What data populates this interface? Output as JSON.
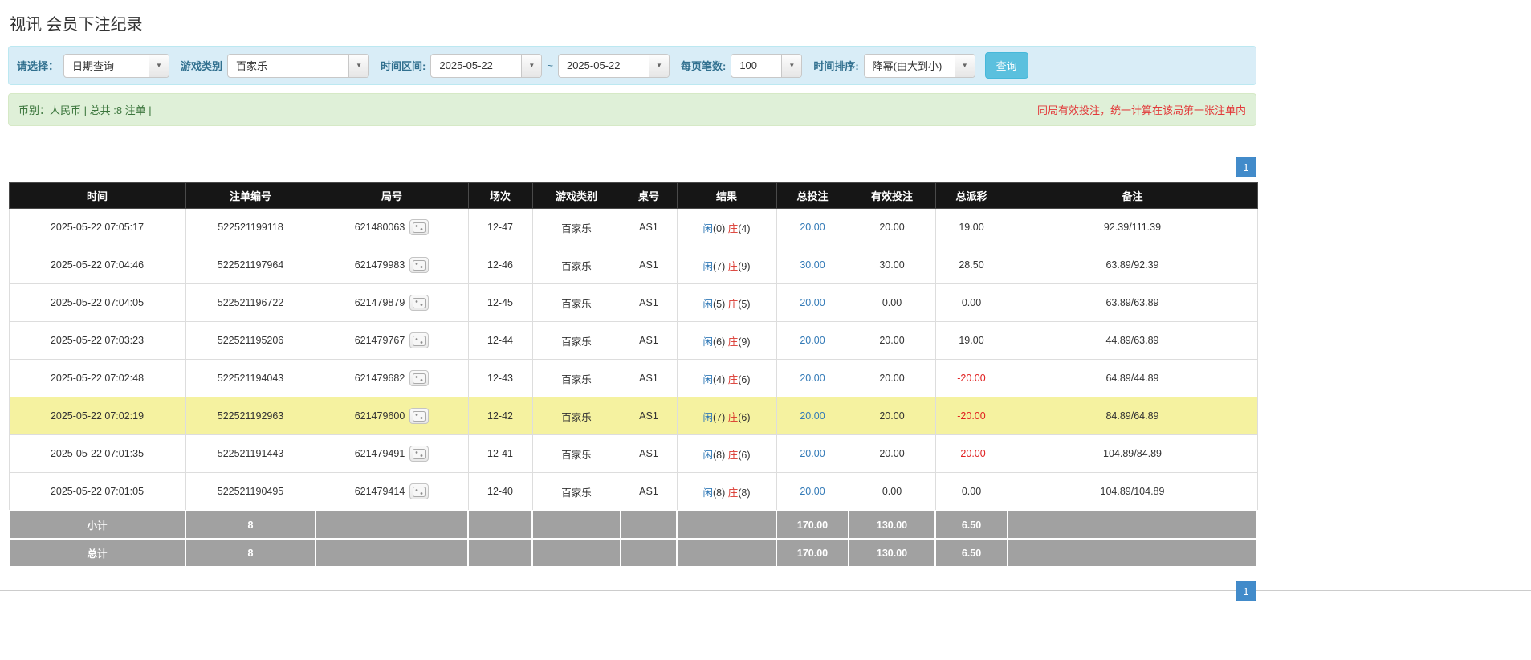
{
  "page": {
    "title": "视讯 会员下注纪录"
  },
  "colors": {
    "accent_blue": "#428bca",
    "link_blue": "#337ab7",
    "banker_red": "#d9342b",
    "negative_red": "#e02020",
    "highlight_yellow": "#f5f2a0",
    "filter_bg": "#d9edf7",
    "summary_bg": "#dff0d8",
    "header_black": "#161616",
    "footer_gray": "#a1a1a1"
  },
  "icons": {
    "dropdown_caret": "▼",
    "round_result_icon": "dice-icon"
  },
  "filters": {
    "select_label": "请选择：",
    "select_value": "日期查询",
    "game_type_label": "游戏类别",
    "game_type_value": "百家乐",
    "time_range_label": "时间区间:",
    "date_from": "2025-05-22",
    "tilde": "~",
    "date_to": "2025-05-22",
    "page_size_label": "每页笔数:",
    "page_size_value": "100",
    "sort_label": "时间排序:",
    "sort_value": "降幂(由大到小)",
    "search_button": "查询"
  },
  "summary": {
    "left": "币别：人民币 | 总共 :8 注单 |",
    "right": "同局有效投注，统一计算在该局第一张注单内"
  },
  "pagination": {
    "page": "1"
  },
  "table": {
    "headers": [
      "时间",
      "注单编号",
      "局号",
      "场次",
      "游戏类别",
      "桌号",
      "结果",
      "总投注",
      "有效投注",
      "总派彩",
      "备注"
    ],
    "rows": [
      {
        "time": "2025-05-22 07:05:17",
        "bet_id": "522521199118",
        "round_id": "621480063",
        "session": "12-47",
        "game": "百家乐",
        "table_no": "AS1",
        "result_player": "闲",
        "result_player_score": "(0)",
        "result_banker": "庄",
        "result_banker_score": "(4)",
        "total_bet": "20.00",
        "valid_bet": "20.00",
        "payout": "19.00",
        "remark": "92.39/111.39",
        "highlight": false
      },
      {
        "time": "2025-05-22 07:04:46",
        "bet_id": "522521197964",
        "round_id": "621479983",
        "session": "12-46",
        "game": "百家乐",
        "table_no": "AS1",
        "result_player": "闲",
        "result_player_score": "(7)",
        "result_banker": "庄",
        "result_banker_score": "(9)",
        "total_bet": "30.00",
        "valid_bet": "30.00",
        "payout": "28.50",
        "remark": "63.89/92.39",
        "highlight": false
      },
      {
        "time": "2025-05-22 07:04:05",
        "bet_id": "522521196722",
        "round_id": "621479879",
        "session": "12-45",
        "game": "百家乐",
        "table_no": "AS1",
        "result_player": "闲",
        "result_player_score": "(5)",
        "result_banker": "庄",
        "result_banker_score": "(5)",
        "total_bet": "20.00",
        "valid_bet": "0.00",
        "payout": "0.00",
        "remark": "63.89/63.89",
        "highlight": false
      },
      {
        "time": "2025-05-22 07:03:23",
        "bet_id": "522521195206",
        "round_id": "621479767",
        "session": "12-44",
        "game": "百家乐",
        "table_no": "AS1",
        "result_player": "闲",
        "result_player_score": "(6)",
        "result_banker": "庄",
        "result_banker_score": "(9)",
        "total_bet": "20.00",
        "valid_bet": "20.00",
        "payout": "19.00",
        "remark": "44.89/63.89",
        "highlight": false
      },
      {
        "time": "2025-05-22 07:02:48",
        "bet_id": "522521194043",
        "round_id": "621479682",
        "session": "12-43",
        "game": "百家乐",
        "table_no": "AS1",
        "result_player": "闲",
        "result_player_score": "(4)",
        "result_banker": "庄",
        "result_banker_score": "(6)",
        "total_bet": "20.00",
        "valid_bet": "20.00",
        "payout": "-20.00",
        "remark": "64.89/44.89",
        "highlight": false
      },
      {
        "time": "2025-05-22 07:02:19",
        "bet_id": "522521192963",
        "round_id": "621479600",
        "session": "12-42",
        "game": "百家乐",
        "table_no": "AS1",
        "result_player": "闲",
        "result_player_score": "(7)",
        "result_banker": "庄",
        "result_banker_score": "(6)",
        "total_bet": "20.00",
        "valid_bet": "20.00",
        "payout": "-20.00",
        "remark": "84.89/64.89",
        "highlight": true
      },
      {
        "time": "2025-05-22 07:01:35",
        "bet_id": "522521191443",
        "round_id": "621479491",
        "session": "12-41",
        "game": "百家乐",
        "table_no": "AS1",
        "result_player": "闲",
        "result_player_score": "(8)",
        "result_banker": "庄",
        "result_banker_score": "(6)",
        "total_bet": "20.00",
        "valid_bet": "20.00",
        "payout": "-20.00",
        "remark": "104.89/84.89",
        "highlight": false
      },
      {
        "time": "2025-05-22 07:01:05",
        "bet_id": "522521190495",
        "round_id": "621479414",
        "session": "12-40",
        "game": "百家乐",
        "table_no": "AS1",
        "result_player": "闲",
        "result_player_score": "(8)",
        "result_banker": "庄",
        "result_banker_score": "(8)",
        "total_bet": "20.00",
        "valid_bet": "0.00",
        "payout": "0.00",
        "remark": "104.89/104.89",
        "highlight": false
      }
    ],
    "subtotal": {
      "label": "小计",
      "count": "8",
      "total_bet": "170.00",
      "valid_bet": "130.00",
      "payout": "6.50"
    },
    "total": {
      "label": "总计",
      "count": "8",
      "total_bet": "170.00",
      "valid_bet": "130.00",
      "payout": "6.50"
    }
  }
}
